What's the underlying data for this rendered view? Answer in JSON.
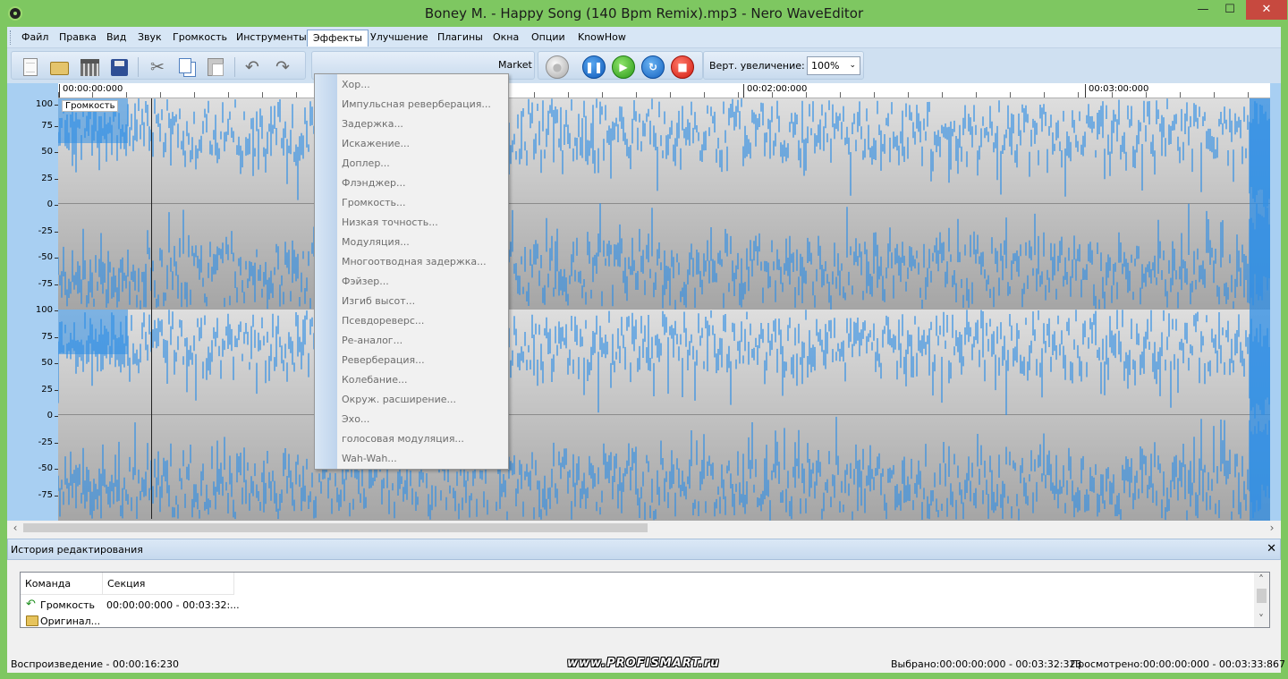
{
  "window": {
    "title": "Boney M. - Happy Song (140 Bpm Remix).mp3 - Nero WaveEditor",
    "minimize": "—",
    "maximize": "☐",
    "close": "✕"
  },
  "menu": {
    "items": [
      "Файл",
      "Правка",
      "Вид",
      "Звук",
      "Громкость",
      "Инструменты",
      "Эффекты",
      "Улучшение",
      "Плагины",
      "Окна",
      "Опции",
      "KnowHow"
    ],
    "active": "Эффекты"
  },
  "toolbar": {
    "market_label": "Market",
    "zoom_label": "Верт. увеличение:",
    "zoom_value": "100%",
    "zoom_arrow": "⌄",
    "icons": [
      "new-document-icon",
      "open-folder-icon",
      "library-icon",
      "save-icon",
      "cut-icon",
      "copy-icon",
      "paste-icon",
      "undo-icon",
      "redo-icon",
      "record-icon",
      "pause-icon",
      "play-icon",
      "loop-icon",
      "stop-icon"
    ],
    "glyphs": {
      "cut": "✂",
      "undo": "↶",
      "redo": "↷",
      "pause": "❚❚",
      "play": "▶",
      "loop": "↻",
      "stop": "■"
    }
  },
  "ruler": {
    "labels": [
      "00:00:00:000",
      "00:02:00:000",
      "00:03:00:000"
    ]
  },
  "scale": {
    "channel1": [
      "100",
      "75",
      "50",
      "25",
      "0",
      "-25",
      "-50",
      "-75"
    ],
    "channel2": [
      "100",
      "75",
      "50",
      "25",
      "0",
      "-25",
      "-50",
      "-75"
    ]
  },
  "track": {
    "volume_tag": "Громкость"
  },
  "scroll": {
    "left_arrow": "‹",
    "right_arrow": "›",
    "up_arrow": "˄",
    "down_arrow": "˅"
  },
  "effects_menu": {
    "items": [
      "Хор...",
      "Импульсная реверберация...",
      "Задержка...",
      "Искажение...",
      "Доплер...",
      "Флэнджер...",
      "Громкость...",
      "Низкая точность...",
      "Модуляция...",
      "Многоотводная задержка...",
      "Фэйзер...",
      "Изгиб высот...",
      "Псевдореверс...",
      "Ре-аналог...",
      "Реверберация...",
      "Колебание...",
      "Окруж. расширение...",
      "Эхо...",
      "голосовая модуляция...",
      "Wah-Wah..."
    ]
  },
  "history": {
    "title": "История редактирования",
    "close": "✕",
    "columns": [
      "Команда",
      "Секция"
    ],
    "rows": [
      {
        "command": "Громкость",
        "section": "00:00:00:000 - 00:03:32:...",
        "icon": "undo-arrow-icon"
      },
      {
        "command": "Оригинал...",
        "section": "",
        "icon": "folder-icon"
      }
    ]
  },
  "status": {
    "playback": "Воспроизведение - 00:00:16:230",
    "watermark": "www.PROFISMART.ru",
    "selected": "Выбрано:00:00:00:000 - 00:03:32:323",
    "viewed": "Просмотрено:00:00:00:000 - 00:03:33:867"
  },
  "colors": {
    "frame": "#7ec761",
    "waveform": "#2e8ee6",
    "menu_active_border": "#7da2ce"
  }
}
